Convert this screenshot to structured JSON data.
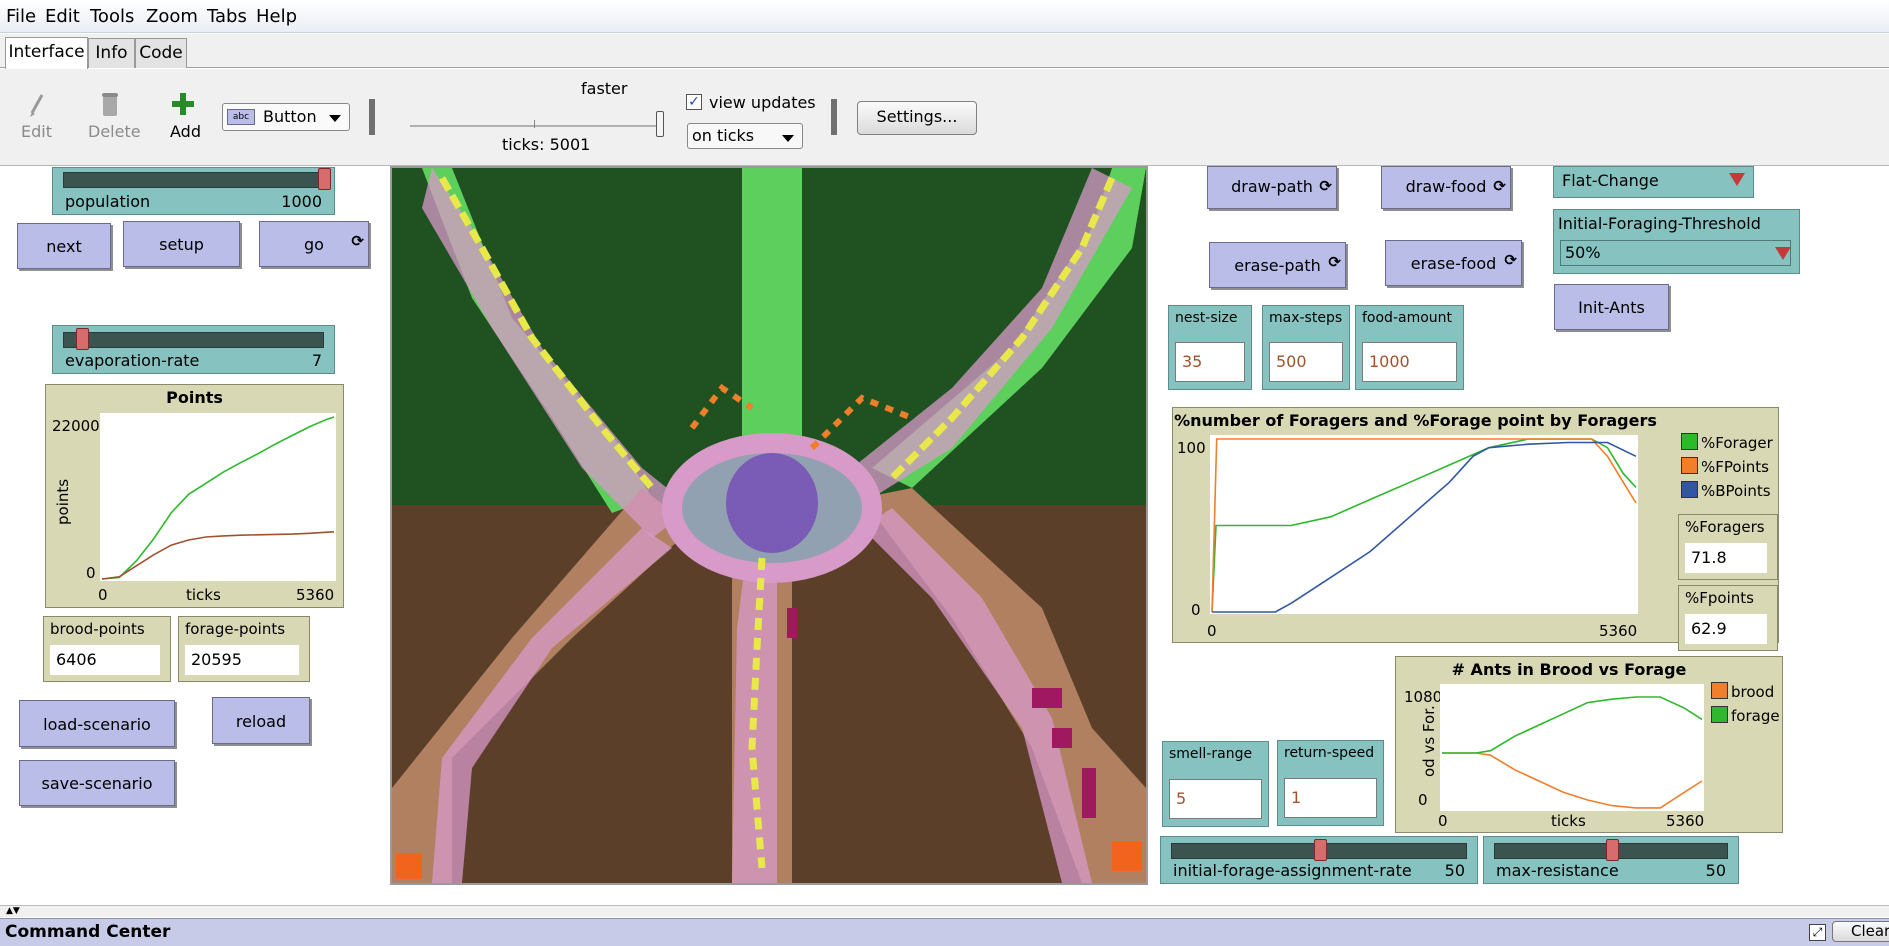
{
  "menu": [
    "File",
    "Edit",
    "Tools",
    "Zoom",
    "Tabs",
    "Help"
  ],
  "tabs": [
    "Interface",
    "Info",
    "Code"
  ],
  "toolbar": {
    "edit_label": "Edit",
    "delete_label": "Delete",
    "add_label": "Add",
    "widget_type": "Button",
    "speed_label": "faster",
    "ticks_label": "ticks: 5001",
    "view_updates_label": "view updates",
    "view_updates_checked": true,
    "update_mode": "on ticks",
    "settings_label": "Settings..."
  },
  "left": {
    "population": {
      "label": "population",
      "value": "1000",
      "fraction": 0.96
    },
    "buttons": {
      "next": "next",
      "setup": "setup",
      "go": "go"
    },
    "evaporation": {
      "label": "evaporation-rate",
      "value": "7",
      "fraction": 0.05
    },
    "brood_points": {
      "label": "brood-points",
      "value": "6406"
    },
    "forage_points": {
      "label": "forage-points",
      "value": "20595"
    },
    "load_scenario": "load-scenario",
    "reload": "reload",
    "save_scenario": "save-scenario"
  },
  "right": {
    "draw_path": "draw-path",
    "draw_food": "draw-food",
    "erase_path": "erase-path",
    "erase_food": "erase-food",
    "flat_change": "Flat-Change",
    "threshold": {
      "label": "Initial-Foraging-Threshold",
      "value": "50%"
    },
    "init_ants": "Init-Ants",
    "nest_size": {
      "label": "nest-size",
      "value": "35"
    },
    "max_steps": {
      "label": "max-steps",
      "value": "500"
    },
    "food_amount": {
      "label": "food-amount",
      "value": "1000"
    },
    "foragers_monitor": {
      "label": "%Foragers",
      "value": "71.8"
    },
    "fpoints_monitor": {
      "label": "%Fpoints",
      "value": "62.9"
    },
    "smell_range": {
      "label": "smell-range",
      "value": "5"
    },
    "return_speed": {
      "label": "return-speed",
      "value": "1"
    },
    "initial_forage": {
      "label": "initial-forage-assignment-rate",
      "value": "50",
      "fraction": 0.5
    },
    "max_resistance": {
      "label": "max-resistance",
      "value": "50",
      "fraction": 0.5
    }
  },
  "command_center": {
    "title": "Command Center",
    "clear": "Clear"
  },
  "chart_data": [
    {
      "type": "line",
      "title": "Points",
      "xlabel": "ticks",
      "ylabel": "points",
      "xlim": [
        0,
        5360
      ],
      "ylim": [
        0,
        22000
      ],
      "x_ticks": [
        "0",
        "5360"
      ],
      "y_ticks": [
        "22000",
        "0"
      ],
      "series": [
        {
          "color": "#2db82d",
          "x": [
            0,
            400,
            800,
            1200,
            1600,
            2000,
            2400,
            2800,
            3200,
            3600,
            4000,
            4400,
            4800,
            5200,
            5360
          ],
          "y": [
            0,
            200,
            2500,
            5500,
            9000,
            11500,
            13000,
            14500,
            15800,
            17000,
            18300,
            19500,
            20700,
            21700,
            22000
          ]
        },
        {
          "color": "#a0522d",
          "x": [
            0,
            400,
            800,
            1200,
            1600,
            2000,
            2400,
            2800,
            3200,
            3600,
            4000,
            4400,
            4800,
            5200,
            5360
          ],
          "y": [
            0,
            300,
            1800,
            3300,
            4600,
            5300,
            5700,
            5850,
            5950,
            6000,
            6050,
            6100,
            6200,
            6350,
            6406
          ]
        }
      ]
    },
    {
      "type": "line",
      "title": "%number of Foragers and %Forage point by Foragers",
      "xlim": [
        0,
        5360
      ],
      "ylim": [
        0,
        100
      ],
      "x_ticks": [
        "0",
        "5360"
      ],
      "y_ticks": [
        "100",
        "0"
      ],
      "series": [
        {
          "name": "%Forager",
          "color": "#2db82d",
          "x": [
            0,
            50,
            1000,
            1500,
            2000,
            2500,
            3000,
            3500,
            4000,
            4500,
            4800,
            5000,
            5200,
            5360
          ],
          "y": [
            0,
            50,
            50,
            55,
            65,
            75,
            85,
            95,
            100,
            100,
            100,
            95,
            80,
            72
          ]
        },
        {
          "name": "%FPoints",
          "color": "#f07e2a",
          "x": [
            0,
            60,
            500,
            1000,
            2000,
            3000,
            4000,
            4500,
            4800,
            5000,
            5200,
            5360
          ],
          "y": [
            0,
            100,
            100,
            100,
            100,
            100,
            100,
            100,
            100,
            90,
            75,
            63
          ]
        },
        {
          "name": "%BPoints",
          "color": "#3156a3",
          "x": [
            0,
            800,
            1000,
            1500,
            2000,
            2500,
            3000,
            3300,
            3500,
            4000,
            4500,
            5000,
            5360
          ],
          "y": [
            0,
            0,
            5,
            20,
            35,
            55,
            75,
            90,
            95,
            97,
            98,
            98,
            90
          ]
        }
      ]
    },
    {
      "type": "line",
      "title": "# Ants in Brood vs Forage",
      "xlabel": "ticks",
      "ylabel": "od vs For.",
      "xlim": [
        0,
        5360
      ],
      "ylim": [
        0,
        1080
      ],
      "x_ticks": [
        "0",
        "5360"
      ],
      "y_ticks": [
        "1080",
        "0"
      ],
      "series": [
        {
          "name": "brood",
          "color": "#f07e2a",
          "x": [
            0,
            700,
            1000,
            1500,
            2000,
            2500,
            3000,
            3500,
            4000,
            4500,
            5000,
            5360
          ],
          "y": [
            500,
            500,
            480,
            350,
            250,
            150,
            80,
            30,
            10,
            10,
            150,
            250
          ]
        },
        {
          "name": "forage",
          "color": "#2db82d",
          "x": [
            0,
            700,
            1000,
            1500,
            2000,
            2500,
            3000,
            3500,
            4000,
            4500,
            5000,
            5360
          ],
          "y": [
            500,
            500,
            520,
            650,
            750,
            850,
            950,
            980,
            1000,
            1000,
            900,
            800
          ]
        }
      ]
    }
  ],
  "colors": {
    "button": "#b9bde8",
    "slider": "#86c3c0",
    "monitor": "#d8d8b5",
    "green_field": "#1f5220",
    "brown_field": "#5b3f28",
    "nest": "#7a5bb5"
  }
}
